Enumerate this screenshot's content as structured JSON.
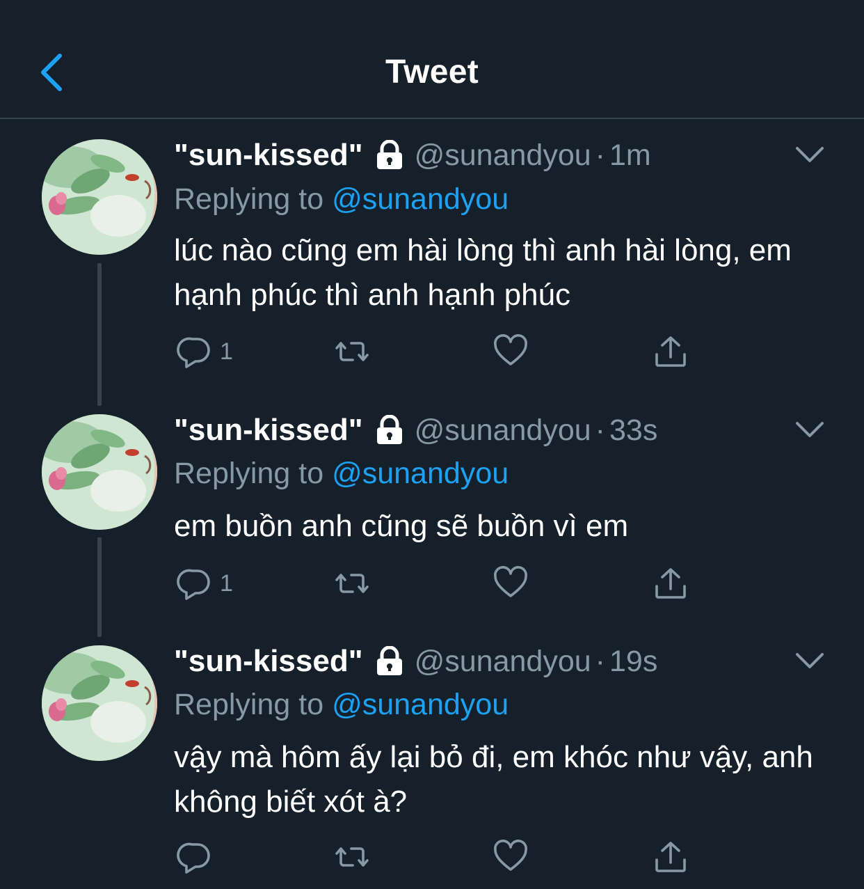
{
  "header": {
    "title": "Tweet",
    "back_icon": "chevron-left-icon"
  },
  "colors": {
    "background": "#15202b",
    "accent": "#1da1f2",
    "secondary_text": "#8899a6",
    "divider": "#38444d"
  },
  "tweets": [
    {
      "display_name": "\"sun-kissed\"",
      "protected_icon": "lock-icon",
      "handle": "@sunandyou",
      "separator": "·",
      "time": "1m",
      "replying_prefix": "Replying to ",
      "replying_to": "@sunandyou",
      "text": "lúc nào cũng em hài lòng thì anh hài lòng, em hạnh phúc thì anh hạnh phúc",
      "reply_count": "1"
    },
    {
      "display_name": "\"sun-kissed\"",
      "protected_icon": "lock-icon",
      "handle": "@sunandyou",
      "separator": "·",
      "time": "33s",
      "replying_prefix": "Replying to ",
      "replying_to": "@sunandyou",
      "text": "em buồn anh cũng sẽ buồn vì em",
      "reply_count": "1"
    },
    {
      "display_name": "\"sun-kissed\"",
      "protected_icon": "lock-icon",
      "handle": "@sunandyou",
      "separator": "·",
      "time": "19s",
      "replying_prefix": "Replying to ",
      "replying_to": "@sunandyou",
      "text": "vậy mà hôm ấy lại bỏ đi, em khóc như vậy, anh không biết xót à?",
      "reply_count": ""
    }
  ],
  "action_icons": [
    "reply-icon",
    "retweet-icon",
    "like-icon",
    "share-icon"
  ]
}
